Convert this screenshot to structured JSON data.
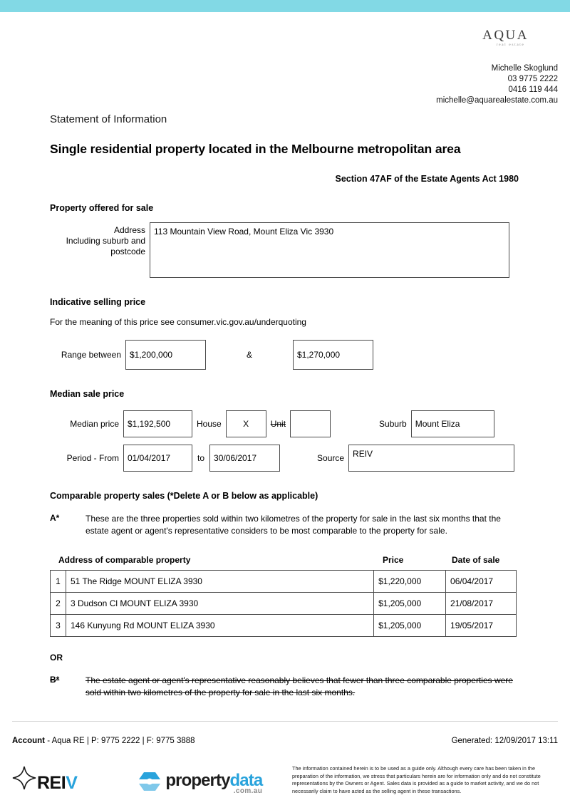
{
  "theme": {
    "top_bar_color": "#82d9e5",
    "accent_blue": "#29a3dc"
  },
  "header": {
    "logo_word": "AQUA",
    "logo_subtitle": "real estate",
    "agent_name": "Michelle Skoglund",
    "phone_office": "03 9775 2222",
    "phone_mobile": "0416 119 444",
    "email": "michelle@aquarealestate.com.au"
  },
  "document": {
    "kicker": "Statement of Information",
    "title": "Single residential property located in the Melbourne metropolitan area",
    "section_reference": "Section 47AF of the Estate Agents Act 1980"
  },
  "property_offered": {
    "heading": "Property offered for sale",
    "address_label_line1": "Address",
    "address_label_line2": "Including suburb and",
    "address_label_line3": "postcode",
    "address_value": "113 Mountain View Road, Mount Eliza Vic 3930"
  },
  "indicative_price": {
    "heading": "Indicative selling price",
    "note": "For the meaning of this price see consumer.vic.gov.au/underquoting",
    "range_label": "Range between",
    "range_low": "$1,200,000",
    "ampersand": "&",
    "range_high": "$1,270,000"
  },
  "median_price": {
    "heading": "Median sale price",
    "median_label": "Median price",
    "median_value": "$1,192,500",
    "house_label": "House",
    "house_value": "X",
    "unit_label": "Unit",
    "unit_value": "",
    "suburb_label": "Suburb",
    "suburb_value": "Mount Eliza",
    "period_label": "Period - From",
    "period_from": "01/04/2017",
    "to_label": "to",
    "period_to": "30/06/2017",
    "source_label": "Source",
    "source_value": "REIV"
  },
  "comparable_sales": {
    "heading": "Comparable property sales (*Delete A or B below as applicable)",
    "clause_a_key": "A*",
    "clause_a_text": "These are the three properties sold within two kilometres of the property for sale in the last six months that the estate agent or agent's representative considers to be most comparable to the property for sale.",
    "columns": {
      "address": "Address of comparable property",
      "price": "Price",
      "date": "Date of sale"
    },
    "rows": [
      {
        "num": "1",
        "address": "51 The Ridge MOUNT ELIZA 3930",
        "price": "$1,220,000",
        "date": "06/04/2017"
      },
      {
        "num": "2",
        "address": "3 Dudson Cl MOUNT ELIZA 3930",
        "price": "$1,205,000",
        "date": "21/08/2017"
      },
      {
        "num": "3",
        "address": "146 Kunyung Rd MOUNT ELIZA 3930",
        "price": "$1,205,000",
        "date": "19/05/2017"
      }
    ],
    "or_label": "OR",
    "clause_b_key": "B*",
    "clause_b_text": "The estate agent or agent's representative reasonably believes that fewer than three comparable properties were sold within two kilometres of the property for sale in the last six months."
  },
  "footer": {
    "account_label": "Account",
    "account_details": "- Aqua RE   |  P: 9775 2222  |  F: 9775 3888",
    "generated": "Generated: 12/09/2017 13:11",
    "reiv_logo_text": "REI",
    "reiv_logo_accent": "V",
    "propertydata_word1": "property",
    "propertydata_word2": "data",
    "propertydata_domain": ".com.au",
    "disclaimer": "The information contained herein is to be used as a guide only. Although every care has been taken in the preparation of the information, we stress that particulars herein are for information only and do not constitute representations by the Owners or Agent. Sales data is provided as a guide to market activity, and we do not necessarily claim to have acted as the selling agent in these transactions."
  }
}
